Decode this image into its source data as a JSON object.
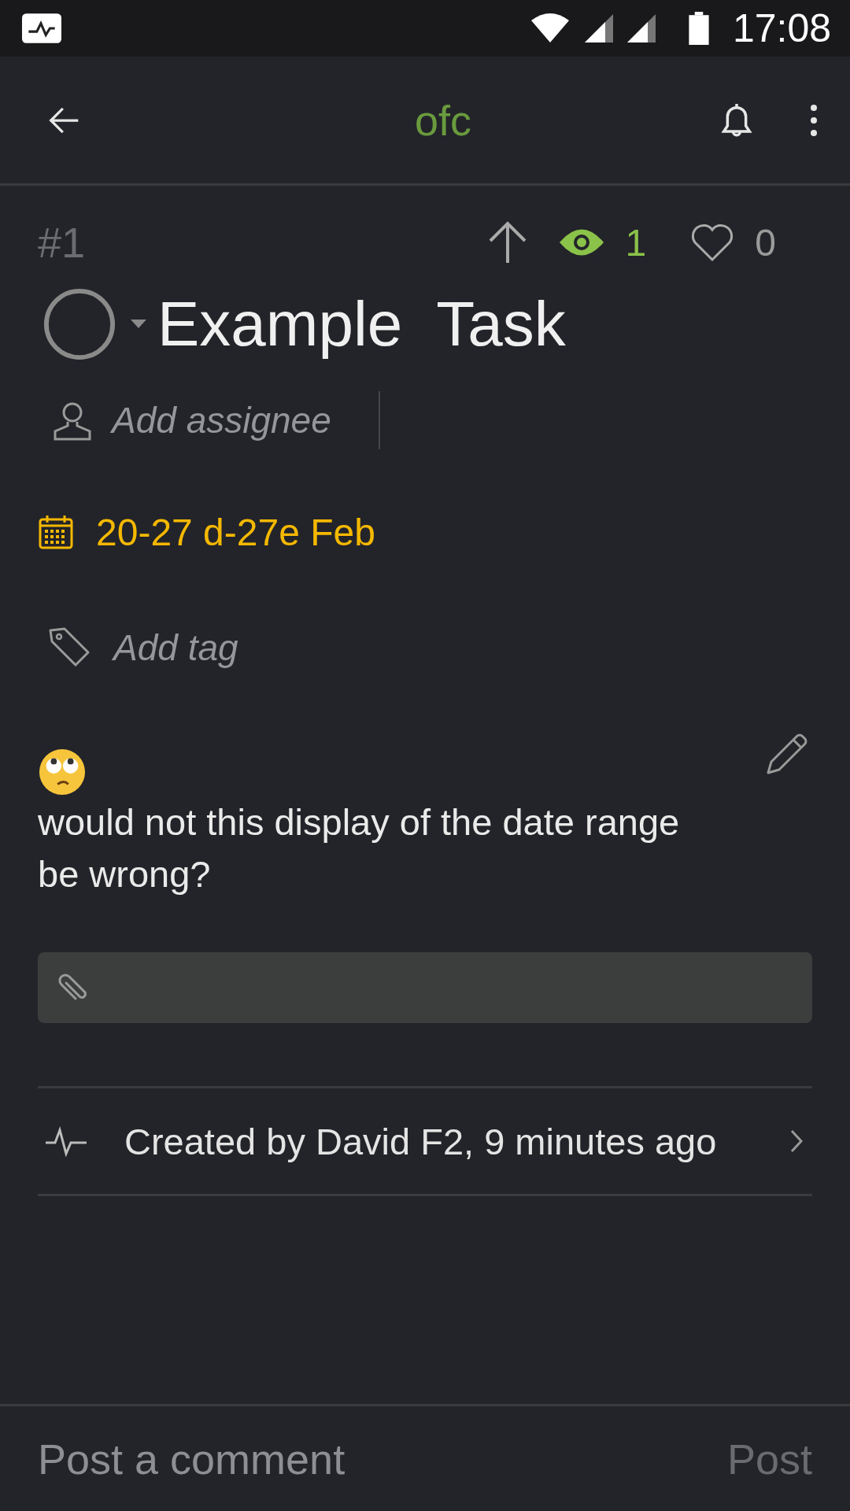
{
  "status_bar": {
    "time": "17:08"
  },
  "app_bar": {
    "title": "ofc"
  },
  "task": {
    "number": "#1",
    "title": "Example  Task",
    "completed": false,
    "views": {
      "count": "1",
      "watching": true
    },
    "likes": {
      "count": "0",
      "liked": false
    },
    "assignee": {
      "placeholder": "Add assignee"
    },
    "due_date": "20-27 d-27e Feb",
    "tag": {
      "placeholder": "Add tag"
    },
    "description": "would not this display of the date range be wrong?"
  },
  "activity": {
    "text": "Created by David F2, 9 minutes ago"
  },
  "comment": {
    "placeholder": "Post a comment",
    "submit": "Post"
  }
}
